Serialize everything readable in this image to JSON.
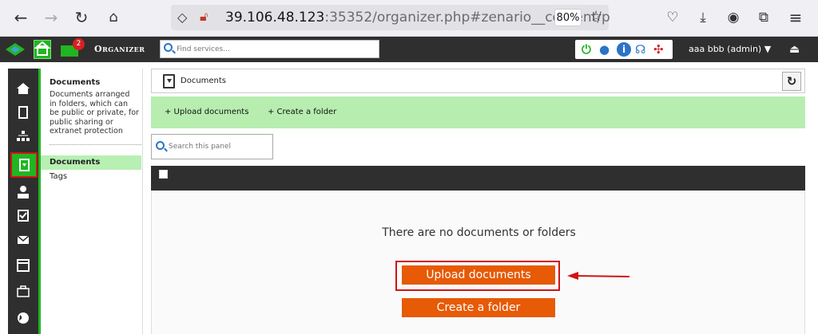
{
  "browser": {
    "url_host": "39.106.48.123",
    "url_rest": ":35352/organizer.php#zenario__content/p",
    "zoom": "80%"
  },
  "header": {
    "title": "Organizer",
    "notification_count": "2",
    "search_placeholder": "Find services...",
    "user": "aaa bbb (admin) ▼"
  },
  "nav": {
    "title": "Documents",
    "description": "Documents arranged in folders, which can be public or private, for public sharing or extranet protection",
    "items": [
      {
        "label": "Documents",
        "selected": true
      },
      {
        "label": "Tags",
        "selected": false
      }
    ]
  },
  "main": {
    "breadcrumb": "Documents",
    "actions": [
      "+ Upload documents",
      "+ Create a folder"
    ],
    "search_placeholder": "Search this panel",
    "empty_message": "There are no documents or folders",
    "upload_button": "Upload documents",
    "create_folder_button": "Create a folder"
  },
  "colors": {
    "accent_green": "#22b522",
    "action_bar": "#b7eeb0",
    "button_orange": "#e75a06",
    "highlight_red": "#d01414"
  }
}
